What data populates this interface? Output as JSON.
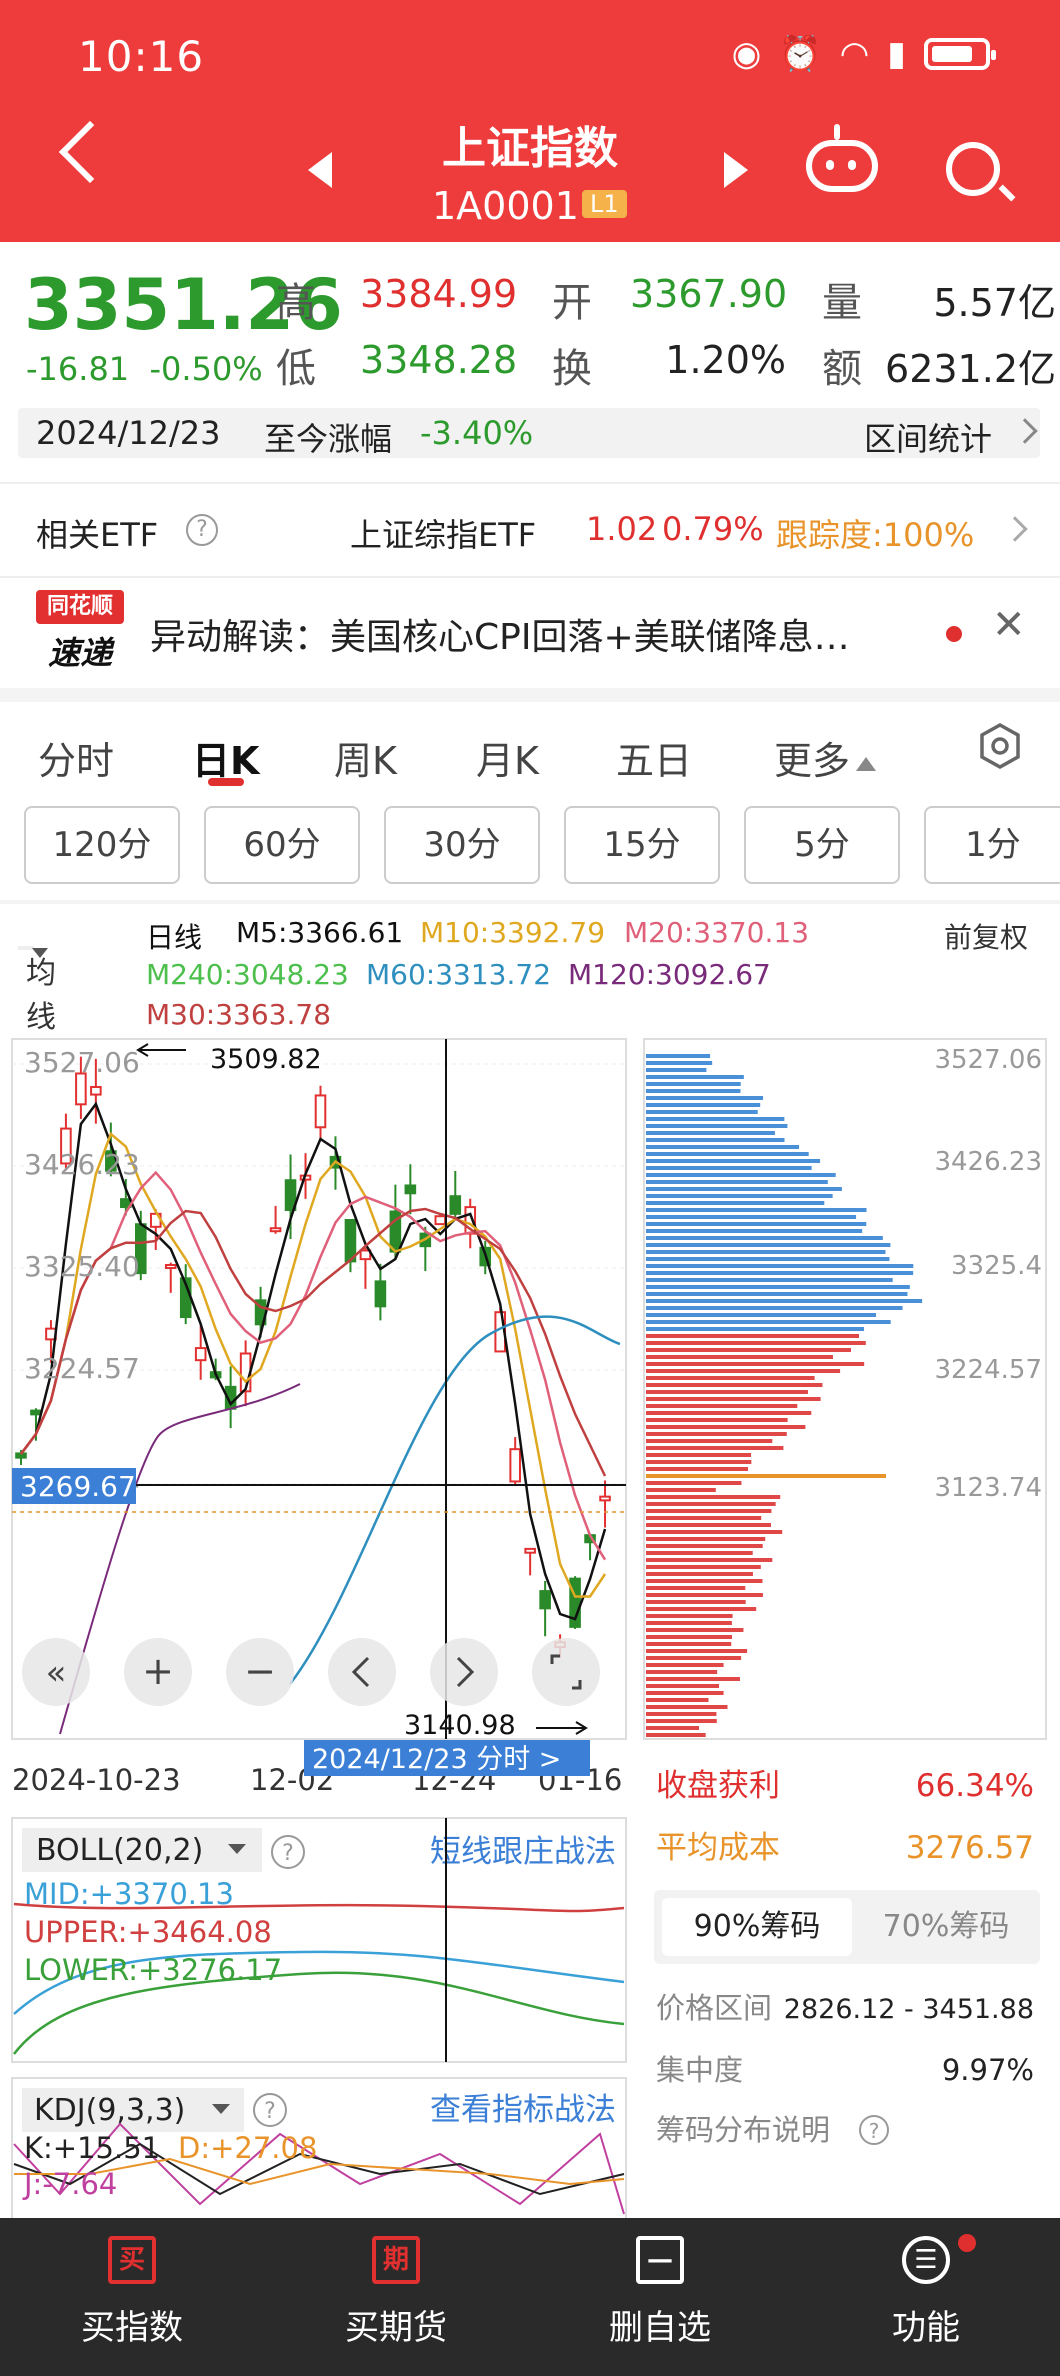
{
  "status_bar": {
    "time": "10:16"
  },
  "header": {
    "title": "上证指数",
    "code": "1A0001",
    "level_badge": "L1"
  },
  "quote": {
    "price": "3351.26",
    "change": "-16.81",
    "change_pct": "-0.50%",
    "high_label": "高",
    "high": "3384.99",
    "open_label": "开",
    "open": "3367.90",
    "volume_label": "量",
    "volume": "5.57亿",
    "low_label": "低",
    "low": "3348.28",
    "turnover_label": "换",
    "turnover": "1.20%",
    "amount_label": "额",
    "amount": "6231.2亿"
  },
  "range_bar": {
    "date": "2024/12/23",
    "label": "至今涨幅",
    "value": "-3.40%",
    "stats_label": "区间统计"
  },
  "etf": {
    "label": "相关ETF",
    "name": "上证综指ETF",
    "price": "1.02",
    "pct": "0.79%",
    "tracking": "跟踪度:100%"
  },
  "news": {
    "logo_top": "同花顺",
    "logo_bottom": "速递",
    "text": "异动解读：美国核心CPI回落+美联储降息…"
  },
  "period_tabs": [
    "分时",
    "日K",
    "周K",
    "月K",
    "五日",
    "更多"
  ],
  "minute_buttons": [
    "120分",
    "60分",
    "30分",
    "15分",
    "5分",
    "1分"
  ],
  "ma_legend": {
    "select": "均线",
    "line": "日线",
    "m5": "M5:3366.61",
    "m10": "M10:3392.79",
    "m20": "M20:3370.13",
    "m240": "M240:3048.23",
    "m60": "M60:3313.72",
    "m120": "M120:3092.67",
    "m30": "M30:3363.78",
    "adjust": "前复权",
    "colors": {
      "m5": "#111111",
      "m10": "#e0a820",
      "m20": "#e0607a",
      "m240": "#4cbf4c",
      "m60": "#2e8fbf",
      "m120": "#7a2a7a",
      "m30": "#c04040"
    }
  },
  "kchart": {
    "y_ticks": [
      "3527.06",
      "3426.23",
      "3325.40",
      "3224.57",
      "3123.74"
    ],
    "high_mark": "3509.82",
    "low_mark": "3140.98",
    "current_price_tag": "3269.67",
    "x_labels": [
      "2024-10-23",
      "12-02",
      "12-24",
      "01-16"
    ],
    "crosshair_tag": "2024/12/23  分时  >"
  },
  "chip_panel": {
    "y_ticks": [
      "3527.06",
      "3426.23",
      "3325.4",
      "3224.57",
      "3123.74"
    ],
    "profit_label": "收盘获利",
    "profit": "66.34%",
    "cost_label": "平均成本",
    "cost": "3276.57",
    "tab90": "90%筹码",
    "tab70": "70%筹码",
    "range_label": "价格区间",
    "range": "2826.12 - 3451.88",
    "conc_label": "集中度",
    "conc": "9.97%",
    "explain": "筹码分布说明"
  },
  "boll": {
    "title": "BOLL(20,2)",
    "strategy": "短线跟庄战法",
    "mid": "MID:+3370.13",
    "upper": "UPPER:+3464.08",
    "lower": "LOWER:+3276.17"
  },
  "kdj": {
    "title": "KDJ(9,3,3)",
    "strategy": "查看指标战法",
    "k": "K:+15.51",
    "d": "D:+27.08",
    "j": "J:-7.64"
  },
  "bottom_nav": [
    {
      "icon": "买",
      "label": "买指数"
    },
    {
      "icon": "期",
      "label": "买期货"
    },
    {
      "icon": "—",
      "label": "删自选"
    },
    {
      "icon": "☰",
      "label": "功能"
    }
  ]
}
